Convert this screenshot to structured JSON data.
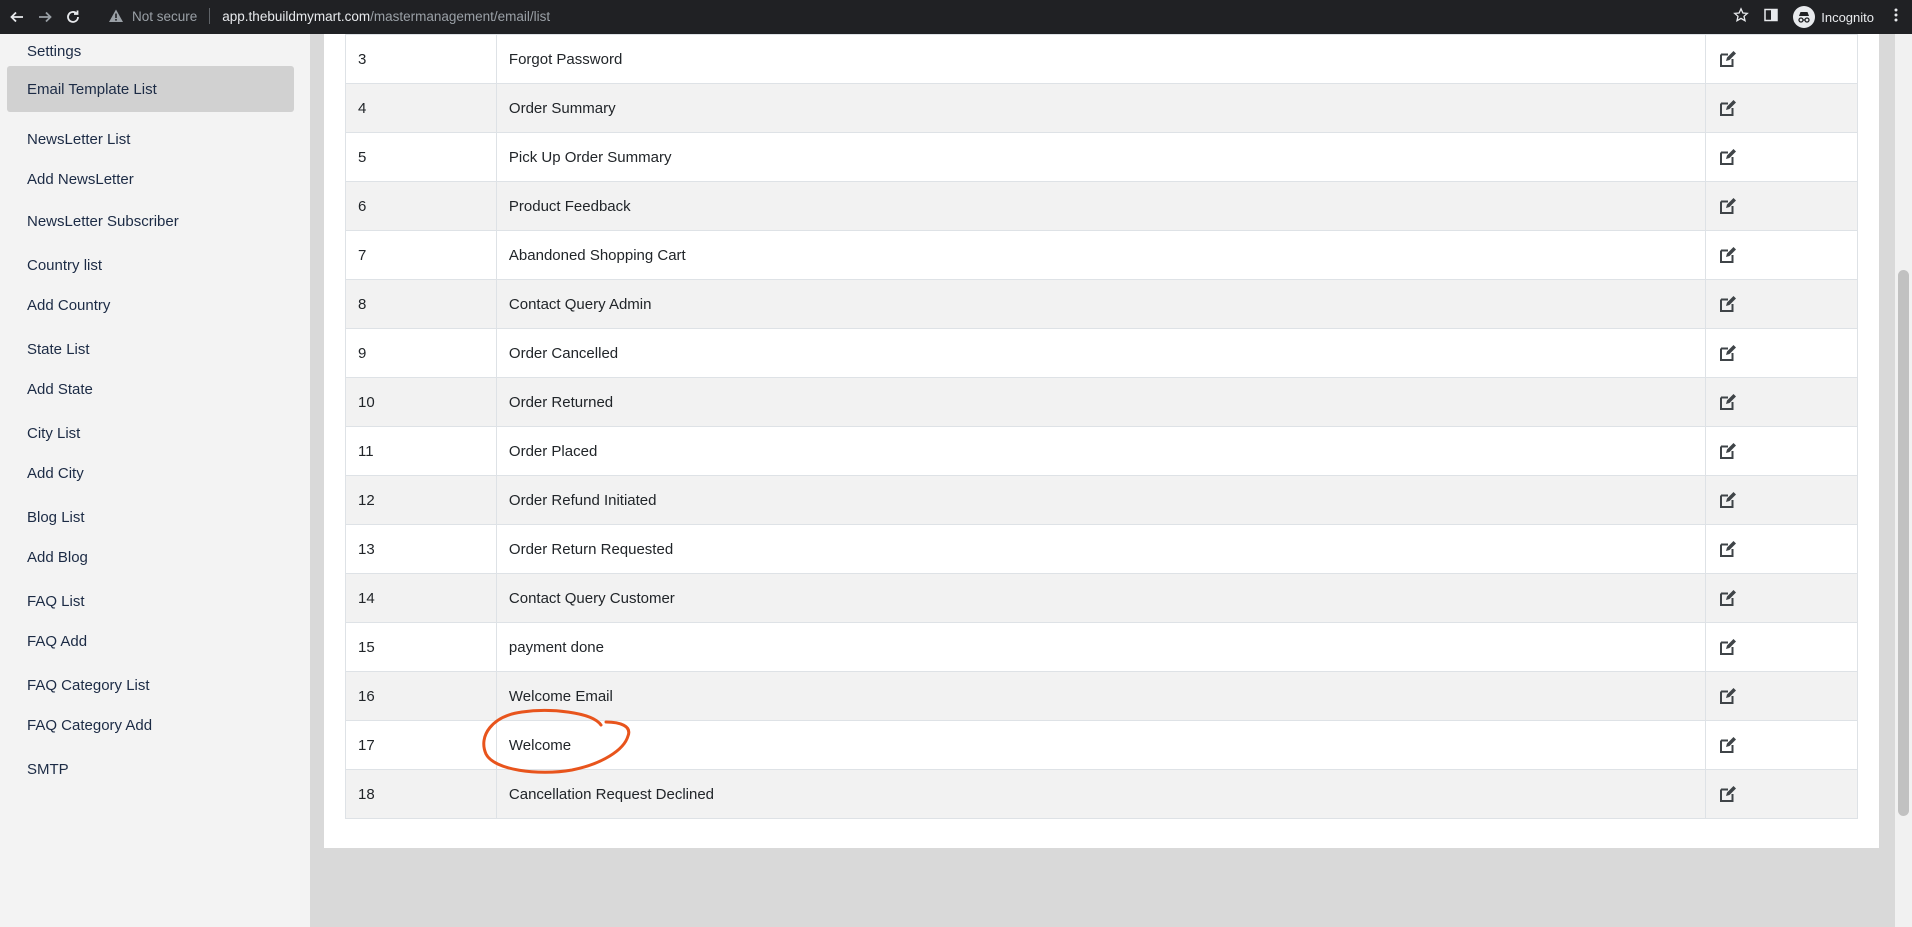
{
  "browser": {
    "security_label": "Not secure",
    "url_host": "app.thebuildmymart.com",
    "url_path": "/mastermanagement/email/list",
    "profile_label": "Incognito"
  },
  "sidebar": {
    "items": [
      {
        "label": "Settings",
        "active": false
      },
      {
        "label": "Email Template List",
        "active": true
      },
      {
        "label": "NewsLetter List",
        "active": false
      },
      {
        "label": "Add NewsLetter",
        "active": false
      },
      {
        "label": "NewsLetter Subscriber",
        "active": false
      },
      {
        "label": "Country list",
        "active": false
      },
      {
        "label": "Add Country",
        "active": false
      },
      {
        "label": "State List",
        "active": false
      },
      {
        "label": "Add State",
        "active": false
      },
      {
        "label": "City List",
        "active": false
      },
      {
        "label": "Add City",
        "active": false
      },
      {
        "label": "Blog List",
        "active": false
      },
      {
        "label": "Add Blog",
        "active": false
      },
      {
        "label": "FAQ List",
        "active": false
      },
      {
        "label": "FAQ Add",
        "active": false
      },
      {
        "label": "FAQ Category List",
        "active": false
      },
      {
        "label": "FAQ Category Add",
        "active": false
      },
      {
        "label": "SMTP",
        "active": false
      }
    ]
  },
  "table": {
    "rows": [
      {
        "id": "3",
        "name": "Forgot Password"
      },
      {
        "id": "4",
        "name": "Order Summary"
      },
      {
        "id": "5",
        "name": "Pick Up Order Summary"
      },
      {
        "id": "6",
        "name": "Product Feedback"
      },
      {
        "id": "7",
        "name": "Abandoned Shopping Cart"
      },
      {
        "id": "8",
        "name": "Contact Query Admin"
      },
      {
        "id": "9",
        "name": "Order Cancelled"
      },
      {
        "id": "10",
        "name": "Order Returned"
      },
      {
        "id": "11",
        "name": "Order Placed"
      },
      {
        "id": "12",
        "name": "Order Refund Initiated"
      },
      {
        "id": "13",
        "name": "Order Return Requested"
      },
      {
        "id": "14",
        "name": "Contact Query Customer"
      },
      {
        "id": "15",
        "name": "payment done"
      },
      {
        "id": "16",
        "name": "Welcome Email"
      },
      {
        "id": "17",
        "name": "Welcome"
      },
      {
        "id": "18",
        "name": "Cancellation Request Declined"
      }
    ],
    "action_icon": "edit-icon"
  },
  "annotation": {
    "shape": "hand-drawn circle",
    "target_row_id": "17",
    "color": "#e8541c"
  },
  "colors": {
    "sidebar_bg": "#f3f3f3",
    "sidebar_active_bg": "#d1d1d1",
    "sidebar_text": "#1c2b45",
    "row_stripe": "#f2f2f2",
    "page_bg": "#d9d9d9"
  }
}
